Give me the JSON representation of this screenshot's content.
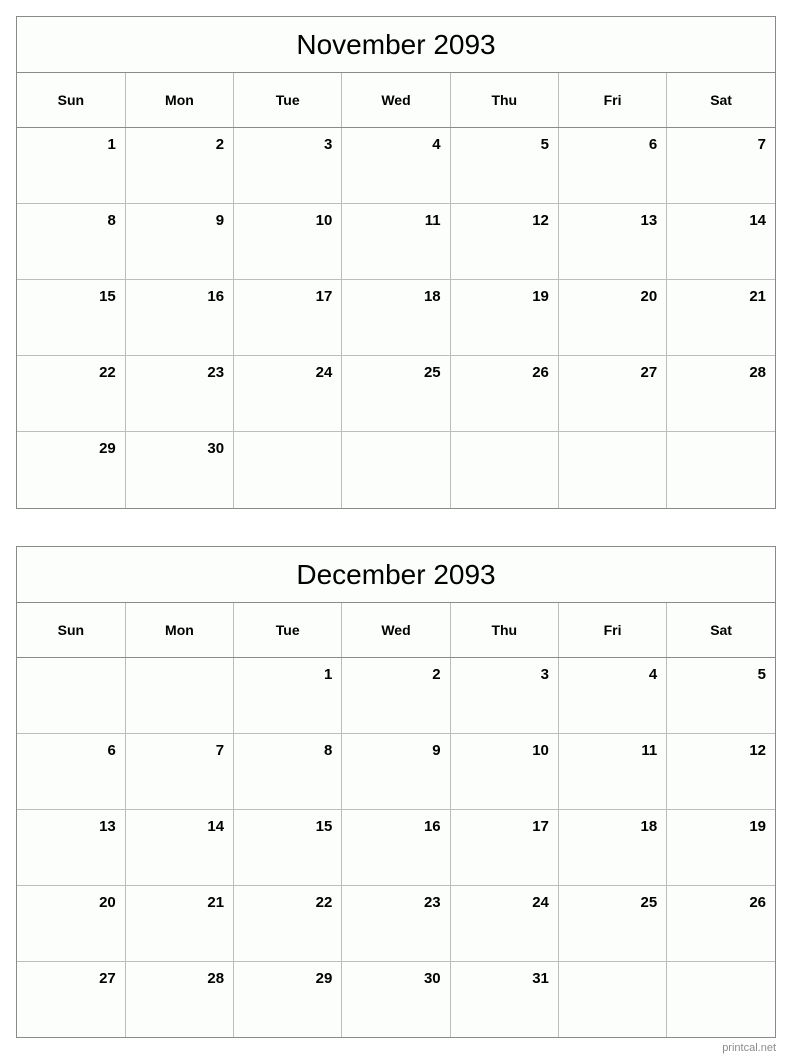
{
  "site": {
    "footer_label": "printcal.net"
  },
  "weekdays": [
    "Sun",
    "Mon",
    "Tue",
    "Wed",
    "Thu",
    "Fri",
    "Sat"
  ],
  "colors": {
    "page_background": "#ffffff",
    "cell_background": "#fcfefb",
    "outer_border": "#8a8a8a",
    "inner_grid": "#bdbdbd",
    "text": "#000000",
    "footer_text": "#8c8c8c"
  },
  "months": [
    {
      "title": "November 2093",
      "weeks": [
        [
          "1",
          "2",
          "3",
          "4",
          "5",
          "6",
          "7"
        ],
        [
          "8",
          "9",
          "10",
          "11",
          "12",
          "13",
          "14"
        ],
        [
          "15",
          "16",
          "17",
          "18",
          "19",
          "20",
          "21"
        ],
        [
          "22",
          "23",
          "24",
          "25",
          "26",
          "27",
          "28"
        ],
        [
          "29",
          "30",
          "",
          "",
          "",
          "",
          ""
        ]
      ]
    },
    {
      "title": "December 2093",
      "weeks": [
        [
          "",
          "",
          "1",
          "2",
          "3",
          "4",
          "5"
        ],
        [
          "6",
          "7",
          "8",
          "9",
          "10",
          "11",
          "12"
        ],
        [
          "13",
          "14",
          "15",
          "16",
          "17",
          "18",
          "19"
        ],
        [
          "20",
          "21",
          "22",
          "23",
          "24",
          "25",
          "26"
        ],
        [
          "27",
          "28",
          "29",
          "30",
          "31",
          "",
          ""
        ]
      ]
    }
  ]
}
